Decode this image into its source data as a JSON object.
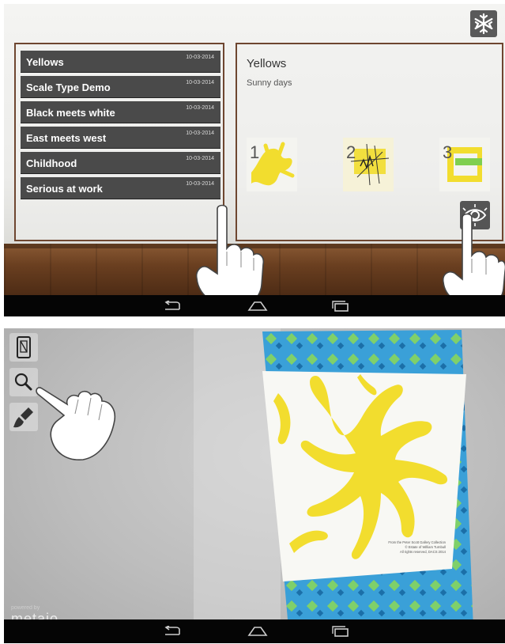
{
  "screen1": {
    "list": [
      {
        "title": "Yellows",
        "date": "10-03-2014"
      },
      {
        "title": "Scale Type Demo",
        "date": "10-03-2014"
      },
      {
        "title": "Black meets white",
        "date": "10-03-2014"
      },
      {
        "title": "East meets west",
        "date": "10-03-2014"
      },
      {
        "title": "Childhood",
        "date": "10-03-2014"
      },
      {
        "title": "Serious at work",
        "date": "10-03-2014"
      }
    ],
    "detail": {
      "title": "Yellows",
      "subtitle": "Sunny days",
      "thumbs": [
        {
          "number": "1",
          "icon": "yellow-organic-shape"
        },
        {
          "number": "2",
          "icon": "yellow-abstract-sketch"
        },
        {
          "number": "3",
          "icon": "yellow-green-squares"
        }
      ]
    },
    "icons": {
      "top_right": "snowflake-icon",
      "eye": "eye-view-icon"
    }
  },
  "screen2": {
    "tools": [
      "phone-frame-icon",
      "magnifier-icon",
      "brush-icon"
    ],
    "watermark": {
      "powered": "powered by",
      "brand": "metaio"
    },
    "art_caption": [
      "From the Peter Scott Gallery Collection",
      "© Estate of William Turnbull",
      "All rights reserved, DACS 2014"
    ]
  },
  "navbar": {
    "icons": [
      "back-icon",
      "home-icon",
      "recents-icon"
    ]
  },
  "colors": {
    "accent_yellow": "#f2dd2e",
    "panel_border": "#6e4630",
    "list_bg": "#4a4a4a",
    "navbar": "#050505"
  }
}
